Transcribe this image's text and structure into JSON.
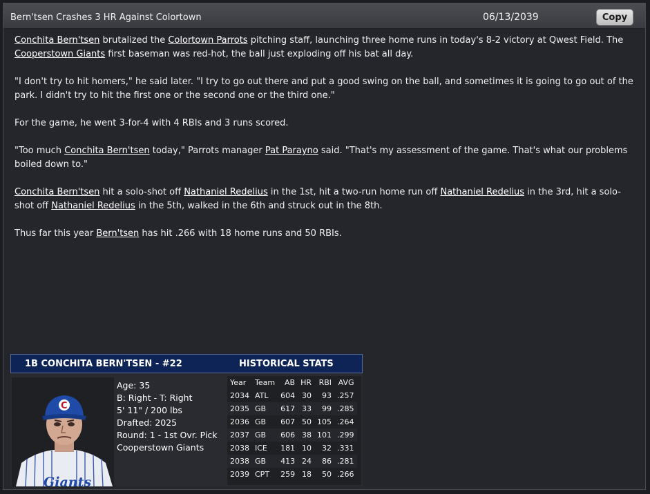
{
  "header": {
    "title": "Bern'tsen Crashes 3 HR Against Colortown",
    "date": "06/13/2039",
    "copy_label": "Copy"
  },
  "article": {
    "p1": [
      {
        "t": "Conchita Bern'tsen",
        "link": true
      },
      {
        "t": " brutalized the "
      },
      {
        "t": "Colortown Parrots",
        "link": true
      },
      {
        "t": " pitching staff, launching three home runs in today's 8-2 victory at Qwest Field. The "
      },
      {
        "t": "Cooperstown Giants",
        "link": true
      },
      {
        "t": " first baseman was red-hot, the ball just exploding off his bat all day."
      }
    ],
    "p2": "\"I don't try to hit homers,\" he said later. \"I try to go out there and put a good swing on the ball, and sometimes it is going to go out of the park. I didn't try to hit the first one or the second one or the third one.\"",
    "p3": "For the game, he went 3-for-4 with 4 RBIs and 3 runs scored.",
    "p4": [
      {
        "t": "\"Too much "
      },
      {
        "t": "Conchita Bern'tsen",
        "link": true
      },
      {
        "t": " today,\" Parrots manager "
      },
      {
        "t": "Pat Parayno",
        "link": true
      },
      {
        "t": " said. \"That's my assessment of the game. That's what our problems boiled down to.\""
      }
    ],
    "p5": [
      {
        "t": "Conchita Bern'tsen",
        "link": true
      },
      {
        "t": " hit a solo-shot off "
      },
      {
        "t": "Nathaniel Redelius",
        "link": true
      },
      {
        "t": " in the 1st, hit a two-run home run off "
      },
      {
        "t": "Nathaniel Redelius",
        "link": true
      },
      {
        "t": " in the 3rd, hit a solo-shot off "
      },
      {
        "t": "Nathaniel Redelius",
        "link": true
      },
      {
        "t": " in the 5th, walked in the 6th and struck out in the 8th."
      }
    ],
    "p6": [
      {
        "t": "Thus far this year "
      },
      {
        "t": "Bern'tsen",
        "link": true
      },
      {
        "t": " has hit .266 with 18 home runs and 50 RBIs."
      }
    ]
  },
  "player_card": {
    "name_line": "1B CONCHITA BERN'TSEN - #22",
    "hist_title": "HISTORICAL STATS",
    "bio": [
      "Age: 35",
      "B: Right - T: Right",
      "5' 11\" / 200 lbs",
      "Drafted: 2025",
      "Round: 1 - 1st Ovr. Pick",
      "Cooperstown Giants"
    ],
    "cap_letter": "C",
    "jersey_text": "Giants",
    "stats_headers": [
      "Year",
      "Team",
      "AB",
      "HR",
      "RBI",
      "AVG"
    ],
    "stats_rows": [
      [
        "2034",
        "ATL",
        "604",
        "30",
        "93",
        ".257"
      ],
      [
        "2035",
        "GB",
        "617",
        "33",
        "99",
        ".285"
      ],
      [
        "2036",
        "GB",
        "607",
        "50",
        "105",
        ".264"
      ],
      [
        "2037",
        "GB",
        "606",
        "38",
        "101",
        ".299"
      ],
      [
        "2038",
        "ICE",
        "181",
        "10",
        "32",
        ".331"
      ],
      [
        "2038",
        "GB",
        "413",
        "24",
        "86",
        ".281"
      ],
      [
        "2039",
        "CPT",
        "259",
        "18",
        "50",
        ".266"
      ]
    ]
  },
  "colors": {
    "card_header": "#0e2456",
    "cap": "#1f4aa8",
    "link": "#ffffff"
  }
}
